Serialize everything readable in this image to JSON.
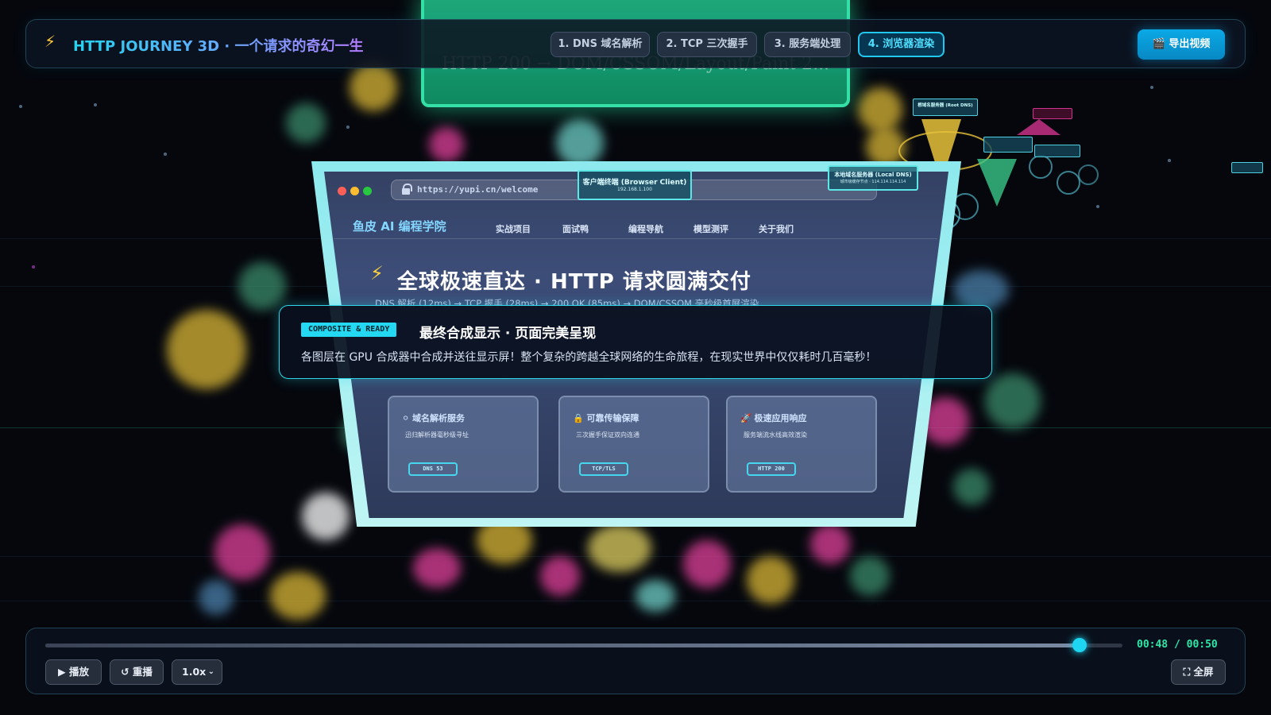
{
  "app": {
    "bolt_icon": "lightning-icon",
    "title": "HTTP JOURNEY 3D · 一个请求的奇幻一生"
  },
  "steps": [
    {
      "label": "1. DNS 域名解析",
      "active": false
    },
    {
      "label": "2. TCP 三次握手",
      "active": false
    },
    {
      "label": "3. 服务端处理",
      "active": false
    },
    {
      "label": "4. 浏览器渲染",
      "active": true
    }
  ],
  "export": {
    "icon": "clapper-icon",
    "label": "🎬 导出视频"
  },
  "scene": {
    "banner_text": "HTTP 200 → DOM/CSSOM/Layout/Paint 2...",
    "browser": {
      "url": "https://yupi.cn/welcome",
      "client_tag": {
        "title": "客户端终端 (Browser Client)",
        "ip": "192.168.1.100"
      },
      "dns_tag": {
        "title": "本地域名服务器 (Local DNS)",
        "ip": "城市级缓存节点 · 114.114.114.114"
      },
      "brand": "鱼皮 AI 编程学院",
      "nav": [
        "实战项目",
        "面试鸭",
        "编程导航",
        "模型测评",
        "关于我们"
      ],
      "hero_title": "全球极速直达 · HTTP 请求圆满交付",
      "hero_sub": "DNS 解析 (12ms) → TCP 握手 (28ms) → 200 OK (85ms) → DOM/CSSOM 毫秒级首屏渲染",
      "cards": [
        {
          "icon": "globe-icon",
          "title": "域名解析服务",
          "desc": "迅归解析器毫秒级寻址",
          "badge": "DNS 53"
        },
        {
          "icon": "lock-icon",
          "title": "可靠传输保障",
          "desc": "三次握手保证双向连通",
          "badge": "TCP/TLS"
        },
        {
          "icon": "rocket-icon",
          "title": "极速应用响应",
          "desc": "服务端流水线高效渲染",
          "badge": "HTTP 200"
        }
      ]
    },
    "right_labels": {
      "root_dns": "根域名服务器 (Root DNS)"
    }
  },
  "overlay": {
    "badge": "COMPOSITE & READY",
    "title": "最终合成显示 · 页面完美呈现",
    "desc": "各图层在 GPU 合成器中合成并送往显示屏！整个复杂的跨越全球网络的生命旅程，在现实世界中仅仅耗时几百毫秒！"
  },
  "player": {
    "progress": 0.96,
    "time": "00:48 / 00:50",
    "play_label": "▶ 播放",
    "replay_label": "↺ 重播",
    "speed": "1.0x",
    "fullscreen_label": "⛶ 全屏"
  },
  "colors": {
    "accent": "#1ec8ee",
    "time_green": "#2ee8a8",
    "banner_green": "#1ea87a"
  }
}
